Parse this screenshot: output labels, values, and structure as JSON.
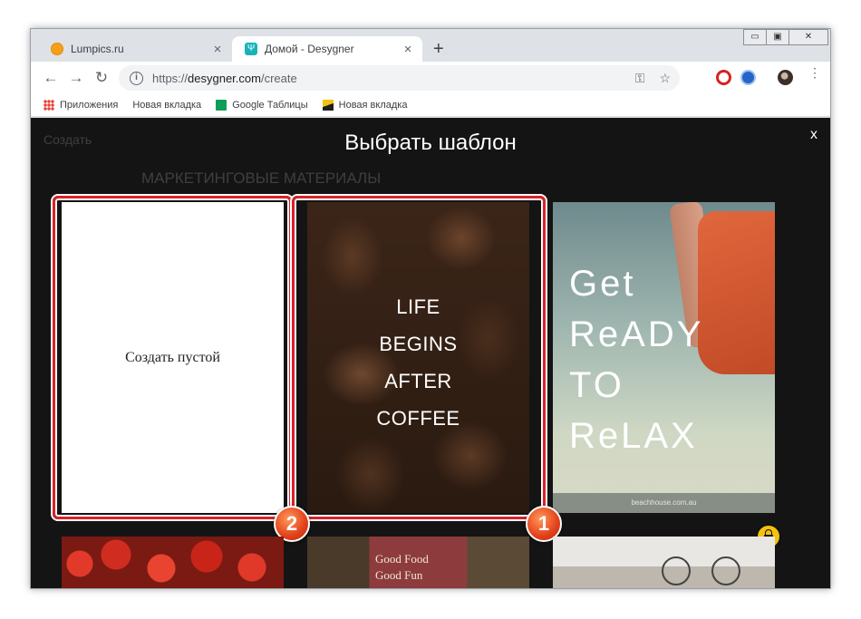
{
  "browser": {
    "tabs": [
      {
        "title": "Lumpics.ru",
        "close": "×"
      },
      {
        "title": "Домой - Desygner",
        "close": "×"
      }
    ],
    "new_tab": "+",
    "window_controls": {
      "minimize": "▭",
      "maximize": "▣",
      "close": "✕"
    },
    "nav": {
      "back": "←",
      "forward": "→",
      "reload": "↻"
    },
    "url": {
      "scheme": "https://",
      "host": "desygner.com",
      "path": "/create"
    },
    "bookmarks": [
      {
        "label": "Приложения",
        "icon": "apps-icon"
      },
      {
        "label": "Новая вкладка",
        "icon": "page-icon"
      },
      {
        "label": "Google Таблицы",
        "icon": "sheets-icon"
      },
      {
        "label": "Новая вкладка",
        "icon": "image-icon"
      }
    ]
  },
  "page": {
    "bg_header": "Создать",
    "bg_section": "МАРКЕТИНГОВЫЕ МАТЕРИАЛЫ",
    "modal_title": "Выбрать шаблон",
    "modal_close": "x",
    "blank_card_label": "Создать пустой",
    "coffee_lines": [
      "LIFE",
      "BEGINS",
      "AFTER",
      "COFFEE"
    ],
    "relax_lines": [
      "Get",
      "ReADY",
      "TO",
      "ReLAX"
    ],
    "relax_footer": "beachhouse.com.au",
    "food_lines": [
      "Good Food",
      "Good Fun"
    ],
    "badges": {
      "coffee": "1",
      "blank": "2"
    }
  },
  "colors": {
    "highlight": "#d8232a",
    "badge": "#e2401a",
    "lock": "#f4c20d"
  }
}
